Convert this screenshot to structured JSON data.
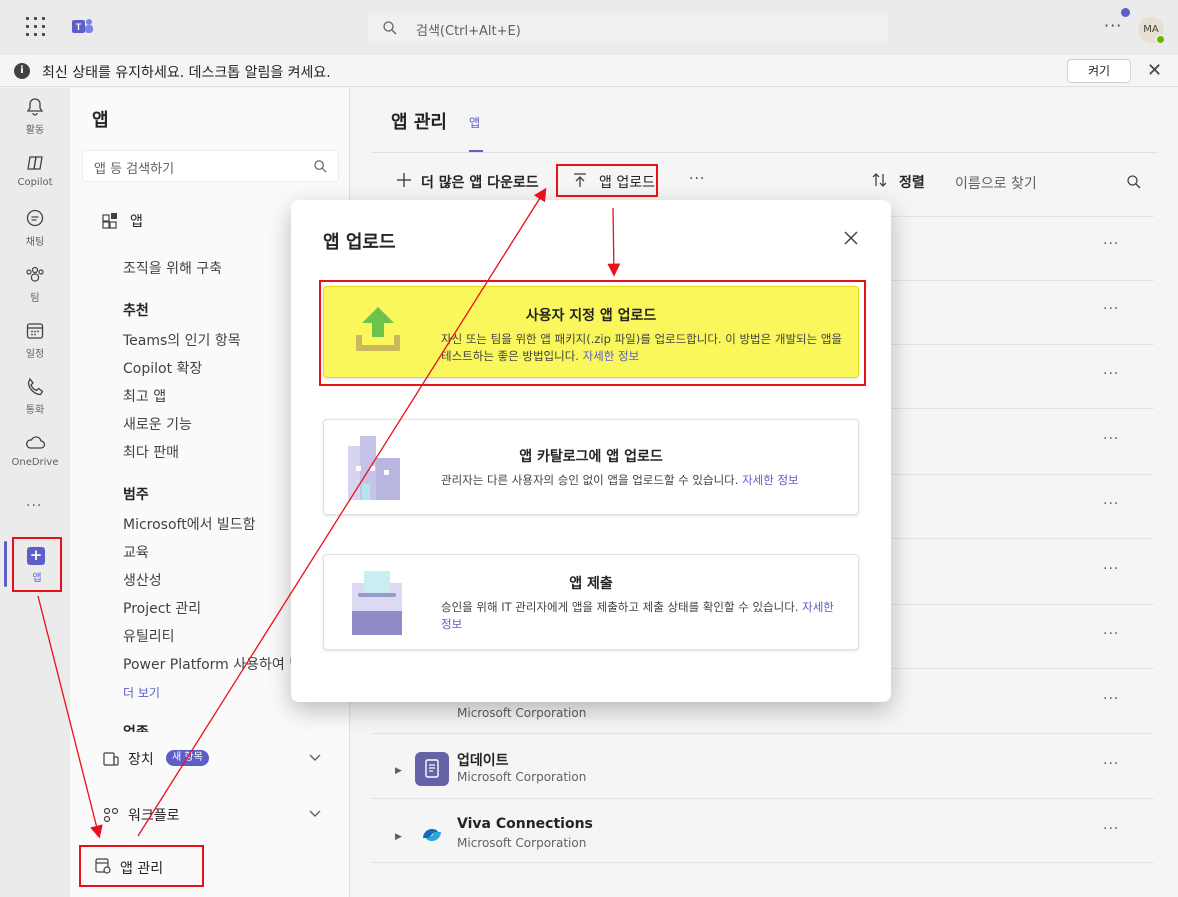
{
  "topbar": {
    "search_placeholder": "검색(Ctrl+Alt+E)",
    "avatar_initials": "MA",
    "more_label": "···"
  },
  "banner": {
    "message": "최신 상태를 유지하세요. 데스크톱 알림을 켜세요.",
    "turn_on_label": "켜기",
    "info_glyph": "i",
    "close_glyph": "✕"
  },
  "rail": {
    "items": [
      {
        "label": "활동",
        "icon": "bell-icon"
      },
      {
        "label": "Copilot",
        "icon": "copilot-icon"
      },
      {
        "label": "채팅",
        "icon": "chat-icon"
      },
      {
        "label": "팀",
        "icon": "teams-icon"
      },
      {
        "label": "일정",
        "icon": "calendar-icon"
      },
      {
        "label": "통화",
        "icon": "phone-icon"
      },
      {
        "label": "OneDrive",
        "icon": "cloud-icon"
      }
    ],
    "more_label": "···",
    "apps_label": "앱"
  },
  "sidebar": {
    "title": "앱",
    "search_placeholder": "앱 등 검색하기",
    "apps_label": "앱",
    "build_label": "조직을 위해 구축",
    "recommended_heading": "추천",
    "recommended": [
      "Teams의 인기 항목",
      "Copilot 확장",
      "최고 앱",
      "새로운 기능",
      "최다 판매"
    ],
    "category_heading": "범주",
    "categories": [
      "Microsoft에서 빌드함",
      "교육",
      "생산성",
      "Project 관리",
      "유틸리티",
      "Power Platform 사용하여 빌"
    ],
    "show_more": "더 보기",
    "partial_heading": "업종",
    "devices_label": "장치",
    "devices_badge": "새 항목",
    "workflows_label": "워크플로",
    "manage_apps_label": "앱 관리"
  },
  "main": {
    "title": "앱 관리",
    "tab_label": "앱",
    "download_more_label": "더 많은 앱 다운로드",
    "upload_label": "앱 업로드",
    "more_label": "···",
    "sort_label": "정렬",
    "find_placeholder": "이름으로 찾기",
    "row_more": "···",
    "rows": [
      {
        "name": "",
        "publisher": "Microsoft Corporation"
      },
      {
        "name": "업데이트",
        "publisher": "Microsoft Corporation"
      },
      {
        "name": "Viva Connections",
        "publisher": "Microsoft Corporation"
      }
    ]
  },
  "modal": {
    "title": "앱 업로드",
    "close_glyph": "✕",
    "options": [
      {
        "title": "사용자 지정 앱 업로드",
        "desc": "자신 또는 팀을 위한 앱 패키지(.zip 파일)를 업로드합니다. 이 방법은 개발되는 앱을 테스트하는 좋은 방법입니다.",
        "link": "자세한 정보"
      },
      {
        "title": "앱 카탈로그에 앱 업로드",
        "desc": "관리자는 다른 사용자의 승인 없이 앱을 업로드할 수 있습니다.",
        "link": "자세한 정보"
      },
      {
        "title": "앱 제출",
        "desc": "승인을 위해 IT 관리자에게 앱을 제출하고 제출 상태를 확인할 수 있습니다.",
        "link": "자세한 정보"
      }
    ]
  },
  "colors": {
    "accent": "#5b5fc7",
    "highlight": "#f9f75c",
    "annotation": "#e8101b",
    "upload_arrow": "#6cc24a"
  }
}
